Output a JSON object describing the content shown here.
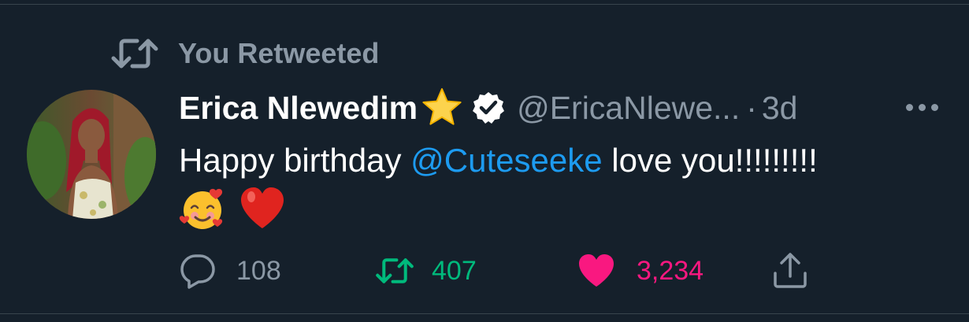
{
  "retweet_context": {
    "label": "You Retweeted",
    "icon": "retweet-icon"
  },
  "tweet": {
    "author_name": "Erica Nlewedim",
    "name_badge_icon": "star-emoji",
    "verified_icon": "verified-badge-icon",
    "handle": "@EricaNlewe...",
    "separator": "·",
    "time": "3d",
    "text_before": "Happy birthday ",
    "mention": "@Cuteseeke",
    "text_after": " love you!!!!!!!!!",
    "emojis": [
      "smiling-face-with-hearts",
      "red-heart"
    ]
  },
  "actions": {
    "reply_count": "108",
    "retweet_count": "407",
    "like_count": "3,234"
  },
  "colors": {
    "background": "#15202b",
    "muted": "#8b98a5",
    "mention": "#1d9bf0",
    "retweet_active": "#00ba7c",
    "like_active": "#f91880"
  }
}
